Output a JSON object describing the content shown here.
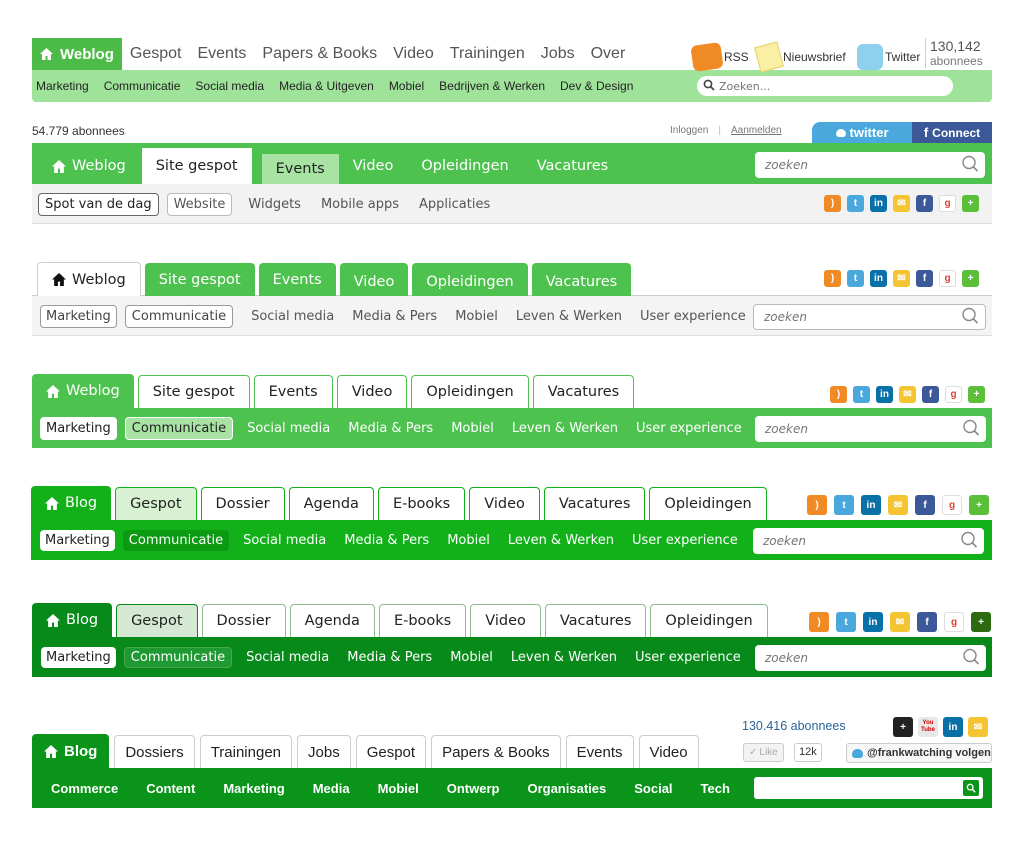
{
  "h1": {
    "home": "Weblog",
    "tabs": [
      "Gespot",
      "Events",
      "Papers & Books",
      "Video",
      "Trainingen",
      "Jobs",
      "Over"
    ],
    "sub": [
      "Marketing",
      "Communicatie",
      "Social media",
      "Media & Uitgeven",
      "Mobiel",
      "Bedrijven & Werken",
      "Dev & Design"
    ],
    "rss": "RSS",
    "news": "Nieuwsbrief",
    "twitter": "Twitter",
    "count": "130,142",
    "count_label": "abonnees",
    "search_placeholder": "Zoeken..."
  },
  "h2": {
    "subscribers": "54.779 abonnees",
    "login": "Inloggen",
    "sep": "|",
    "register": "Aanmelden",
    "twitter_btn": "twitter",
    "connect_btn": "Connect",
    "home": "Weblog",
    "tabs": [
      "Site gespot",
      "Events",
      "Video",
      "Opleidingen",
      "Vacatures"
    ],
    "sub": [
      "Spot van de dag",
      "Website",
      "Widgets",
      "Mobile apps",
      "Applicaties"
    ],
    "search_placeholder": "zoeken"
  },
  "h3": {
    "home": "Weblog",
    "tabs": [
      "Site gespot",
      "Events",
      "Video",
      "Opleidingen",
      "Vacatures"
    ],
    "sub": [
      "Marketing",
      "Communicatie",
      "Social media",
      "Media & Pers",
      "Mobiel",
      "Leven & Werken",
      "User experience"
    ],
    "search_placeholder": "zoeken"
  },
  "h4": {
    "home": "Weblog",
    "tabs": [
      "Site gespot",
      "Events",
      "Video",
      "Opleidingen",
      "Vacatures"
    ],
    "sub": [
      "Marketing",
      "Communicatie",
      "Social media",
      "Media & Pers",
      "Mobiel",
      "Leven & Werken",
      "User experience"
    ],
    "search_placeholder": "zoeken"
  },
  "h5": {
    "home": "Blog",
    "tabs": [
      "Gespot",
      "Dossier",
      "Agenda",
      "E-books",
      "Video",
      "Vacatures",
      "Opleidingen"
    ],
    "sub": [
      "Marketing",
      "Communicatie",
      "Social media",
      "Media & Pers",
      "Mobiel",
      "Leven & Werken",
      "User experience"
    ],
    "search_placeholder": "zoeken"
  },
  "h6": {
    "home": "Blog",
    "tabs": [
      "Gespot",
      "Dossier",
      "Agenda",
      "E-books",
      "Video",
      "Vacatures",
      "Opleidingen"
    ],
    "sub": [
      "Marketing",
      "Communicatie",
      "Social media",
      "Media & Pers",
      "Mobiel",
      "Leven & Werken",
      "User experience"
    ],
    "search_placeholder": "zoeken"
  },
  "h7": {
    "subscribers": "130.416 abonnees",
    "like": "Like",
    "like_count": "12k",
    "follow": "@frankwatching volgen",
    "youtube_label": "You Tube",
    "home": "Blog",
    "tabs": [
      "Dossiers",
      "Trainingen",
      "Jobs",
      "Gespot",
      "Papers & Books",
      "Events",
      "Video"
    ],
    "sub": [
      "Commerce",
      "Content",
      "Marketing",
      "Media",
      "Mobiel",
      "Ontwerp",
      "Organisaties",
      "Social",
      "Tech"
    ],
    "search_placeholder": ""
  },
  "colors": {
    "green1": "#4cbb47",
    "green1_light": "#9fe39a",
    "green2": "#4ec24f",
    "green5": "#12b11a",
    "green6": "#078a1a",
    "green7": "#0a9419"
  }
}
